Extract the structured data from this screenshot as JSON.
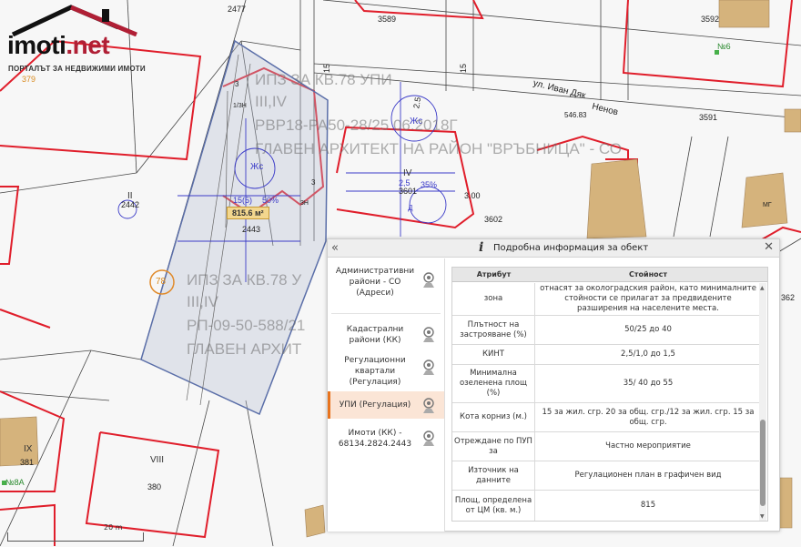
{
  "logo": {
    "brand": "imoti",
    "brand_suffix": ".net",
    "tagline": "ПОРТАЛЪТ ЗА НЕДВИЖИМИ ИМОТИ"
  },
  "map": {
    "parcel_numbers": [
      "2477",
      "3589",
      "3592",
      "3591",
      "3601",
      "3602",
      "2442",
      "2443",
      "380",
      "381",
      "362",
      "379"
    ],
    "street_label_1": "ул. Иван Дяк",
    "street_label_2": "Ненов",
    "street_code": "546.83",
    "lot_roman_1": "II",
    "lot_roman_2": "IV",
    "lot_roman_3": "VIII",
    "lot_roman_4": "IX",
    "lot_roman_5": "II",
    "zone_label_1": "Жс",
    "zone_label_2": "Жс",
    "density_1": "15(5)",
    "density_2": "50%",
    "density_3": "2,5",
    "density_4": "35%",
    "letter_d": "Д",
    "n6": "№6",
    "n8a": "№8А",
    "circle_78": "78",
    "mg": "МГ",
    "watermark_1": "ИПЗ ЗА КВ.78 УПИ",
    "watermark_2": "III,IV",
    "watermark_3": "РВР18-РА50-28/25.06.2018Г",
    "watermark_4": "ГЛАВЕН АРХИТЕКТ НА РАЙОН \"ВРЪБНИЦА\" - СО",
    "watermark_5": "ИПЗ ЗА КВ.78 У",
    "watermark_6": "III,IV",
    "watermark_7": "РП-09-50-588/21",
    "watermark_8": "ГЛАВЕН АРХИТ",
    "dims": [
      "15",
      "15",
      "2.5",
      "3.00",
      "3",
      "3",
      "1/3Н",
      "3Н"
    ],
    "area_label": "815.6 м²",
    "scale_label": "20 m"
  },
  "panel": {
    "collapse_glyph": "«",
    "info_glyph": "i",
    "title": "Подробна информация за обект",
    "close_glyph": "✕",
    "layers": [
      {
        "label": "Административни райони - СО (Адреси)",
        "active": false
      },
      {
        "label": "Кадастрални райони (КК)",
        "active": false
      },
      {
        "label": "Регулационни квартали (Регулация)",
        "active": false
      },
      {
        "label": "УПИ (Регулация)",
        "active": true
      },
      {
        "label": "Имоти (КК) - 68134.2824.2443",
        "active": false
      }
    ],
    "table": {
      "col_attr": "Атрибут",
      "col_value": "Стойност",
      "rows": [
        {
          "attr": "зона",
          "value": "отнасят за околоградския район, като минималните стойности се прилагат за предвидените разширения на населените места."
        },
        {
          "attr": "Плътност на застрояване (%)",
          "value": "50/25 до 40"
        },
        {
          "attr": "КИНТ",
          "value": "2,5/1,0 до 1,5"
        },
        {
          "attr": "Минимална озеленена площ (%)",
          "value": "35/ 40 до 55"
        },
        {
          "attr": "Кота корниз (м.)",
          "value": "15 за жил. сгр. 20 за общ. сгр./12 за жил. сгр. 15 за общ. сгр."
        },
        {
          "attr": "Отреждане по ПУП за",
          "value": "Частно мероприятие"
        },
        {
          "attr": "Източник на данните",
          "value": "Регулационен план в графичен вид"
        },
        {
          "attr": "Площ, определена от ЦМ (кв. м.)",
          "value": "815"
        }
      ]
    },
    "scroll_up": "▲",
    "scroll_down": "▼"
  }
}
